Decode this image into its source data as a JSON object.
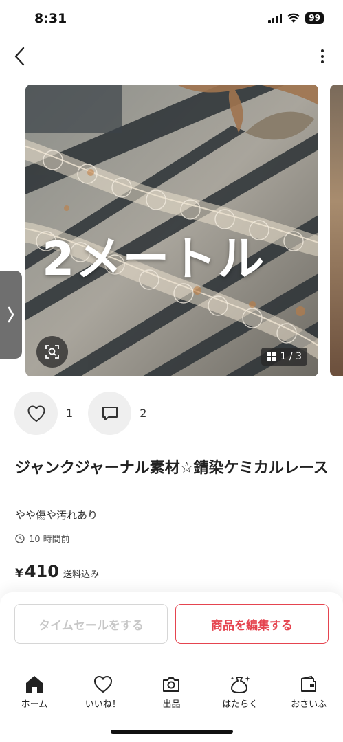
{
  "status_bar": {
    "time": "8:31",
    "battery": "99"
  },
  "photo": {
    "overlay_text": "2メートル",
    "counter": "1 / 3"
  },
  "actions": {
    "likes": "1",
    "comments": "2"
  },
  "item": {
    "title": "ジャンクジャーナル素材☆錆染ケミカルレース",
    "condition": "やや傷や汚れあり",
    "posted": "10 時間前",
    "currency": "¥",
    "price": "410",
    "shipping": "送料込み"
  },
  "buttons": {
    "time_sale": "タイムセールをする",
    "edit": "商品を編集する"
  },
  "tabbar": [
    {
      "label": "ホーム",
      "icon": "home-icon"
    },
    {
      "label": "いいね！",
      "icon": "heart-icon"
    },
    {
      "label": "出品",
      "icon": "camera-icon"
    },
    {
      "label": "はたらく",
      "icon": "money-bag-icon"
    },
    {
      "label": "おさいふ",
      "icon": "wallet-icon"
    }
  ],
  "colors": {
    "accent": "#e5444f",
    "disabled": "#c7c7c7"
  }
}
